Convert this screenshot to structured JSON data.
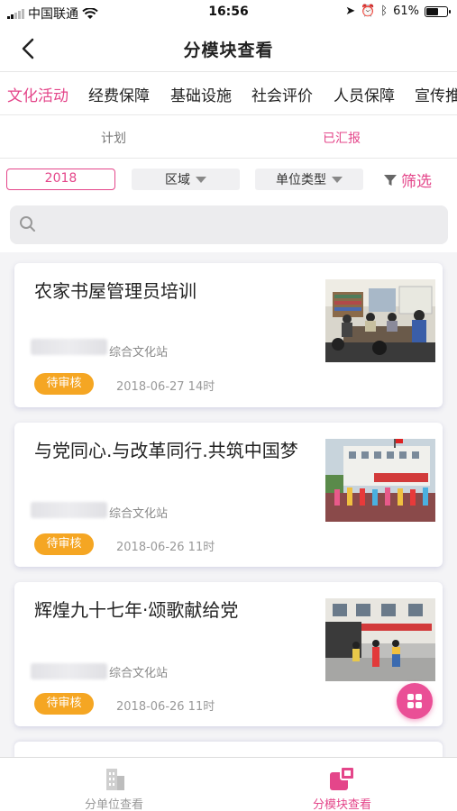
{
  "status": {
    "carrier": "中国联通",
    "time": "16:56",
    "battery": "61%",
    "battery_level": 0.61
  },
  "nav": {
    "title": "分模块查看"
  },
  "categories": [
    "文化活动",
    "经费保障",
    "基础设施",
    "社会评价",
    "人员保障",
    "宣传推"
  ],
  "subtabs": [
    "计划",
    "已汇报"
  ],
  "filters": {
    "year": "2018",
    "region": "区域",
    "unit_type": "单位类型",
    "filter_label": "筛选",
    "search_placeholder": ""
  },
  "cards": [
    {
      "title": "农家书屋管理员培训",
      "station": "综合文化站",
      "status": "待审核",
      "date": "2018-06-27 14时"
    },
    {
      "title": "与党同心.与改革同行.共筑中国梦",
      "station": "综合文化站",
      "status": "待审核",
      "date": "2018-06-26 11时"
    },
    {
      "title": "辉煌九十七年·颂歌献给党",
      "station": "综合文化站",
      "status": "待审核",
      "date": "2018-06-26 11时"
    }
  ],
  "tabbar": {
    "left": "分单位查看",
    "right": "分模块查看"
  },
  "colors": {
    "accent": "#e4468a",
    "badge": "#f5a623"
  }
}
